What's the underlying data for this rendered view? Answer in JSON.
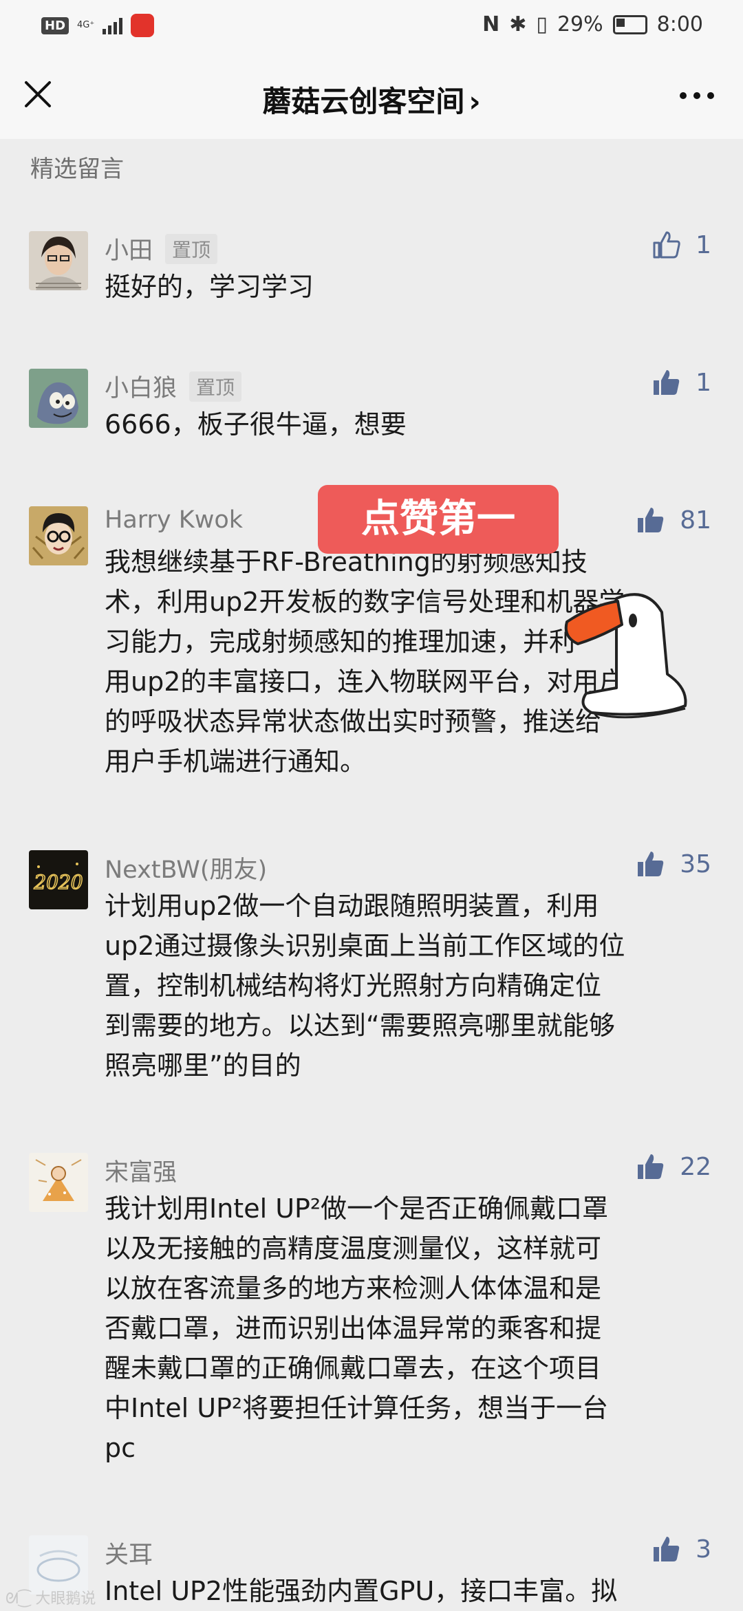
{
  "status_bar": {
    "hd": "HD",
    "network": "4G⁺",
    "battery": "29%",
    "time": "8:00"
  },
  "nav": {
    "title": "蘑菇云创客空间",
    "title_chevron": "›"
  },
  "section_label": "精选留言",
  "overlay": {
    "banner_text": "点赞第一"
  },
  "pin_label": "置顶",
  "comments": [
    {
      "name": "小田",
      "pinned": true,
      "likes": "1",
      "liked": false,
      "text": "挺好的，学习学习"
    },
    {
      "name": "小白狼",
      "pinned": true,
      "likes": "1",
      "liked": true,
      "text": "6666，板子很牛逼，想要"
    },
    {
      "name": "Harry Kwok",
      "pinned": false,
      "likes": "81",
      "liked": true,
      "text": "我想继续基于RF-Breathing的射频感知技\n术，利用up2开发板的数字信号处理和机器学\n习能力，完成射频感知的推理加速，并利\n用up2的丰富接口，连入物联网平台，对用户\n的呼吸状态异常状态做出实时预警，推送给\n用户手机端进行通知。"
    },
    {
      "name": "NextBW(朋友)",
      "pinned": false,
      "likes": "35",
      "liked": true,
      "text": "计划用up2做一个自动跟随照明装置，利用\nup2通过摄像头识别桌面上当前工作区域的位\n置，控制机械结构将灯光照射方向精确定位\n到需要的地方。以达到“需要照亮哪里就能够\n照亮哪里”的目的"
    },
    {
      "name": "宋富强",
      "pinned": false,
      "likes": "22",
      "liked": true,
      "text": "我计划用Intel UP²做一个是否正确佩戴口罩\n以及无接触的高精度温度测量仪，这样就可\n以放在客流量多的地方来检测人体体温和是\n否戴口罩，进而识别出体温异常的乘客和提\n醒未戴口罩的正确佩戴口罩去，在这个项目\n中Intel UP²将要担任计算任务，想当于一台\npc"
    },
    {
      "name": "关耳",
      "pinned": false,
      "likes": "3",
      "liked": true,
      "text": "Intel UP2性能强劲内置GPU，接口丰富。拟"
    }
  ],
  "watermark": "大眼鹅说",
  "colors": {
    "background": "#ededed",
    "link_blue": "#576b95",
    "banner_red": "#ee5b59"
  }
}
